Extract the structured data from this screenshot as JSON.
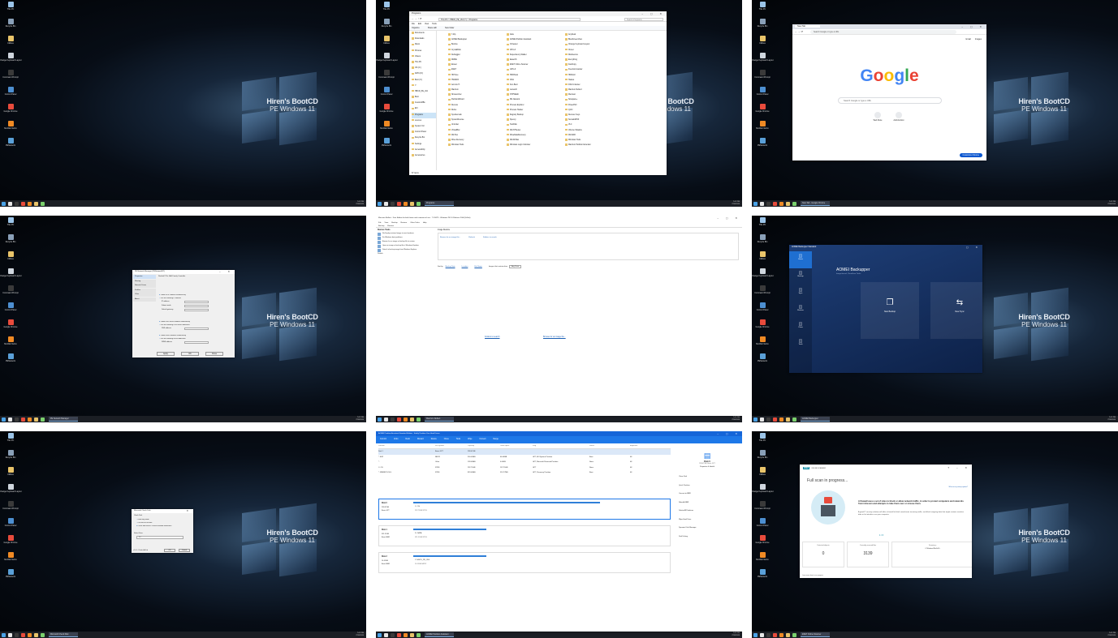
{
  "desktop": {
    "brand_line1": "Hiren's BootCD",
    "brand_line2": "PE Windows 11",
    "icons": [
      "This PC",
      "Recycle Bin",
      "Utilities",
      "Change Keyboard Layout",
      "Command Prompt",
      "Control Panel",
      "Google Chrome",
      "Mozilla Firefox",
      "PENetwork"
    ],
    "icon_colors": [
      "#9bc4e8",
      "#8aa0b8",
      "#e9c46a",
      "#cfd6de",
      "#3a3a3a",
      "#4d8fd1",
      "#e84b3c",
      "#f08a24",
      "#5aa0d8"
    ],
    "tray_time": "7:02 PM",
    "tray_date": "7/30/2024"
  },
  "tiles": [
    {
      "taskbar_app": ""
    },
    {
      "taskbar_app": "Programs",
      "explorer": {
        "title": "Programs",
        "breadcrumb": "This PC  >  HBCD_PE_x64 (Y:)  >  Programs",
        "search_placeholder": "Search Programs",
        "menu": [
          "File",
          "Edit",
          "View",
          "Tools"
        ],
        "toolbar": [
          "Organize",
          "Share with",
          "New folder"
        ],
        "nav": [
          "Documents",
          "Downloads",
          "Music",
          "Pictures",
          "Videos",
          "This PC",
          "OS (C:)",
          "DATA (D:)",
          "Boot (X:)",
          "Y:",
          "HBCD_PE_x64",
          "Boot",
          "CustomMBs",
          "EFI",
          "Programs",
          "sources",
          "System Vol",
          "Control Panel",
          "Recycle Bin",
          "Settings",
          "Accessibility",
          "Accessories"
        ],
        "col1": [
          "7-Zip",
          "AOMEI Backupper",
          "Bootice",
          "CrystalDisk",
          "Defraggler",
          "DMDE",
          "Eraser",
          "ESET",
          "HDTune",
          "HWiNFO",
          "Acronis TI",
          "Macrium",
          "NirLauncher",
          "PartitionWizard",
          "Recuva",
          "Rufus",
          "Sysinternals",
          "SystemRescue",
          "Unlocker",
          "VirtualBox",
          "WinHex",
          "Wise Recovery",
          "Windows Tools"
        ],
        "col2": [
          "Aida",
          "AOMEI Partition Assistant",
          "CCleaner",
          "CPU-Z",
          "Dependency Walker",
          "EaseUS",
          "ESET Online Scanner",
          "GPU-Z",
          "HDDScan",
          "IObit",
          "Kon-Boot",
          "Lazesoft",
          "NTPWEdit",
          "PE Network",
          "Process Explorer",
          "Process Hacker",
          "Registry Backup",
          "Speccy",
          "TestDisk",
          "WinNTSetup",
          "WiseDataRecovery",
          "WinDirStat",
          "Windows Login Unlocker"
        ],
        "col3": [
          "AnyDesk",
          "BlueScreenView",
          "Change Keyboard Layout",
          "Clover",
          "DiskGenius",
          "Everything",
          "FastCopy",
          "FreeCommander",
          "HDDLLF",
          "Hasleo",
          "IObit Unlocker",
          "Macrium Reflect",
          "Memtest",
          "Notepad++",
          "PowerISO",
          "Q-Dir",
          "Recover Keys",
          "SumatraPDF",
          "VLC",
          "Volume Shadow",
          "WinRAR",
          "Windows Tools",
          "Macrium Partition Extender"
        ],
        "status": "67 items"
      }
    },
    {
      "taskbar_app": "New Tab - Google Chrome",
      "chrome": {
        "tab": "New Tab",
        "address_placeholder": "Search Google or type a URL",
        "logo": "Google",
        "search_placeholder": "Search Google or type a URL",
        "top_links": [
          "Gmail",
          "Images"
        ],
        "shortcuts": [
          "Web Store",
          "Add shortcut"
        ],
        "customize": "Customize Chrome"
      }
    },
    {
      "taskbar_app": "PE Network Manager",
      "penetwork": {
        "title": "PE Network Manager (PENetworkNT)",
        "sidebar": [
          "Properties",
          "Sharing",
          "Network Drives",
          "Profiles",
          "Other",
          "About"
        ],
        "adapter": "Realtek PCIe GbE Family Controller",
        "options": [
          "Obtain an IP address automatically",
          "Use the following IP address",
          "Obtain DNS server address automatically",
          "Use the following DNS server addresses",
          "Obtain WINS address automatically",
          "Use the following WINS addresses"
        ],
        "fields": [
          "IP address",
          "Subnet mask",
          "Default gateway",
          "DNS address",
          "WINS address"
        ],
        "buttons": [
          "Apply",
          "OK",
          "Close"
        ]
      }
    },
    {
      "taskbar_app": "Macrium Reflect",
      "macrium": {
        "title": "Macrium Reflect - Free Edition for both home and commercial use - 7.3.5875 - Windows PE 10 Release 2004 (64-bit)",
        "menu": [
          "File",
          "View",
          "Backup",
          "Restore",
          "Other Tasks",
          "Help"
        ],
        "tabs": [
          "Backup",
          "Restore"
        ],
        "tasks_header": "Restore Tasks",
        "tasks": [
          "Re-Deploy restored image to new hardware",
          "Fix Windows boot problems",
          "Browse for an image or backup file to restore",
          "Open an image or backup file in Windows Explorer",
          "Detach a backup image from Windows Explorer"
        ],
        "details": "Details",
        "panel_title": "Image Restore",
        "panel_links": [
          "Browse for an image file...",
          "Refresh",
          "Folders to search"
        ],
        "sort_links": [
          "Backup Date",
          "Location",
          "File Name"
        ],
        "sort_label": "Sort by",
        "filter_label": "Images that contain drive",
        "filter_value": "Any Drive",
        "center_links": [
          "Folders to search",
          "Browse for an image file..."
        ]
      }
    },
    {
      "taskbar_app": "AOMEI Backupper",
      "aomei_backupper": {
        "title": "AOMEI Backupper Standard",
        "nav": [
          "Home",
          "Backup",
          "Sync",
          "Restore",
          "Clone",
          "Tools"
        ],
        "heading": "AOMEI Backupper",
        "subtitle": "Image-based, Cloud-free Tasks",
        "cards": [
          "New Backup",
          "New Sync"
        ]
      }
    },
    {
      "taskbar_app": "Microsoft Check Disk",
      "checkdisk": {
        "title": "Microsoft Check Disk",
        "section": "Check Disk",
        "options": [
          "Read-only mode",
          "Fix errors on the disk",
          "Locate bad sectors / recover readable information"
        ],
        "drive_label": "Select Drive",
        "drive_value": "D:\\",
        "version": "v1.0.1 - Pchub Hall Ltd",
        "buttons": [
          "OK",
          "Cancel"
        ]
      }
    },
    {
      "taskbar_app": "AOMEI Partition Assistant",
      "aomei_pa": {
        "title": "AOMEI Partition Assistant Standard Edition - Safely Partition Your Hard Drives",
        "toolbar": [
          "Commit",
          "Undo",
          "Redo",
          "Discard",
          "Resize",
          "Clone",
          "Tools",
          "Wipe",
          "Convert",
          "Merge"
        ],
        "columns": [
          "Partition",
          "File System",
          "Capacity",
          "Used Space",
          "Flag",
          "Status",
          "Alignment"
        ],
        "rows": [
          [
            "Disk 1",
            "Basic GPT",
            "238.47GB",
            "",
            "",
            "",
            ""
          ],
          [
            "*: ESP",
            "FAT32",
            "300.00MB",
            "66.00MB",
            "GPT, EFI System Partition",
            "Boot",
            "4K"
          ],
          [
            "*:",
            "Other",
            "128.00MB",
            "0.00KB",
            "GPT, Microsoft Reserved Partition",
            "None",
            "4K"
          ],
          [
            "C: OS",
            "NTFS",
            "232.79GB",
            "137.29GB",
            "GPT",
            "None",
            "4K"
          ],
          [
            "*: WINRETOOLS",
            "NTFS",
            "823.00MB",
            "513.77MB",
            "GPT, Recovery Partition",
            "Boot",
            "4K"
          ]
        ],
        "disks": [
          {
            "name": "Disk 0",
            "size": "238.47GB",
            "type": "Basic GPT",
            "part": "C: OS",
            "detail": "232.79GB NTFS"
          },
          {
            "name": "Disk 1",
            "size": "931.51GB",
            "type": "Basic MBR",
            "part": "D: DATA",
            "detail": "931.51GB NTFS"
          },
          {
            "name": "Disk 2",
            "size": "14.45GB",
            "type": "Basic MBR",
            "part": "Y: HBCD_PE_X64",
            "detail": "14.45GB FAT32"
          }
        ],
        "side_title": "Disk 0",
        "side_subtitle": "238.47GB, Basic GPT",
        "side_status": "Properties & Health",
        "side_actions": [
          "Clone Disk",
          "Quick Partition",
          "Convert to MBR",
          "Rebuild MBR",
          "Delete All Partitions",
          "Wipe Hard Drive",
          "Dynamic Disk Manager",
          "Disk Defrag"
        ]
      }
    },
    {
      "taskbar_app": "ESET Online Scanner",
      "eset": {
        "brand": "ESET",
        "product": "ONLINE SCANNER",
        "heading": "Full scan in progress...",
        "help_link": "What are my startup options?",
        "tip_title": "A firewall uses a set of rules to block or allow network traffic, in order to protect computers and networks from intrusion and attempts to take them over or misuse them.",
        "tip_body": "A good IT security solution will offer a firewall to block unwelcome incoming traffic, and block outgoing data that might contain sensitive data or let intruders use your computer.",
        "pager": "1 / 6",
        "stats": [
          {
            "label": "Detected objects",
            "value": "0"
          },
          {
            "label": "Currently scanned files",
            "value": "3139"
          },
          {
            "label": "Scanning...",
            "value": "C:\\Windows\\WinSxS\\..."
          }
        ],
        "footer": "Learn more about scan progress"
      }
    }
  ]
}
